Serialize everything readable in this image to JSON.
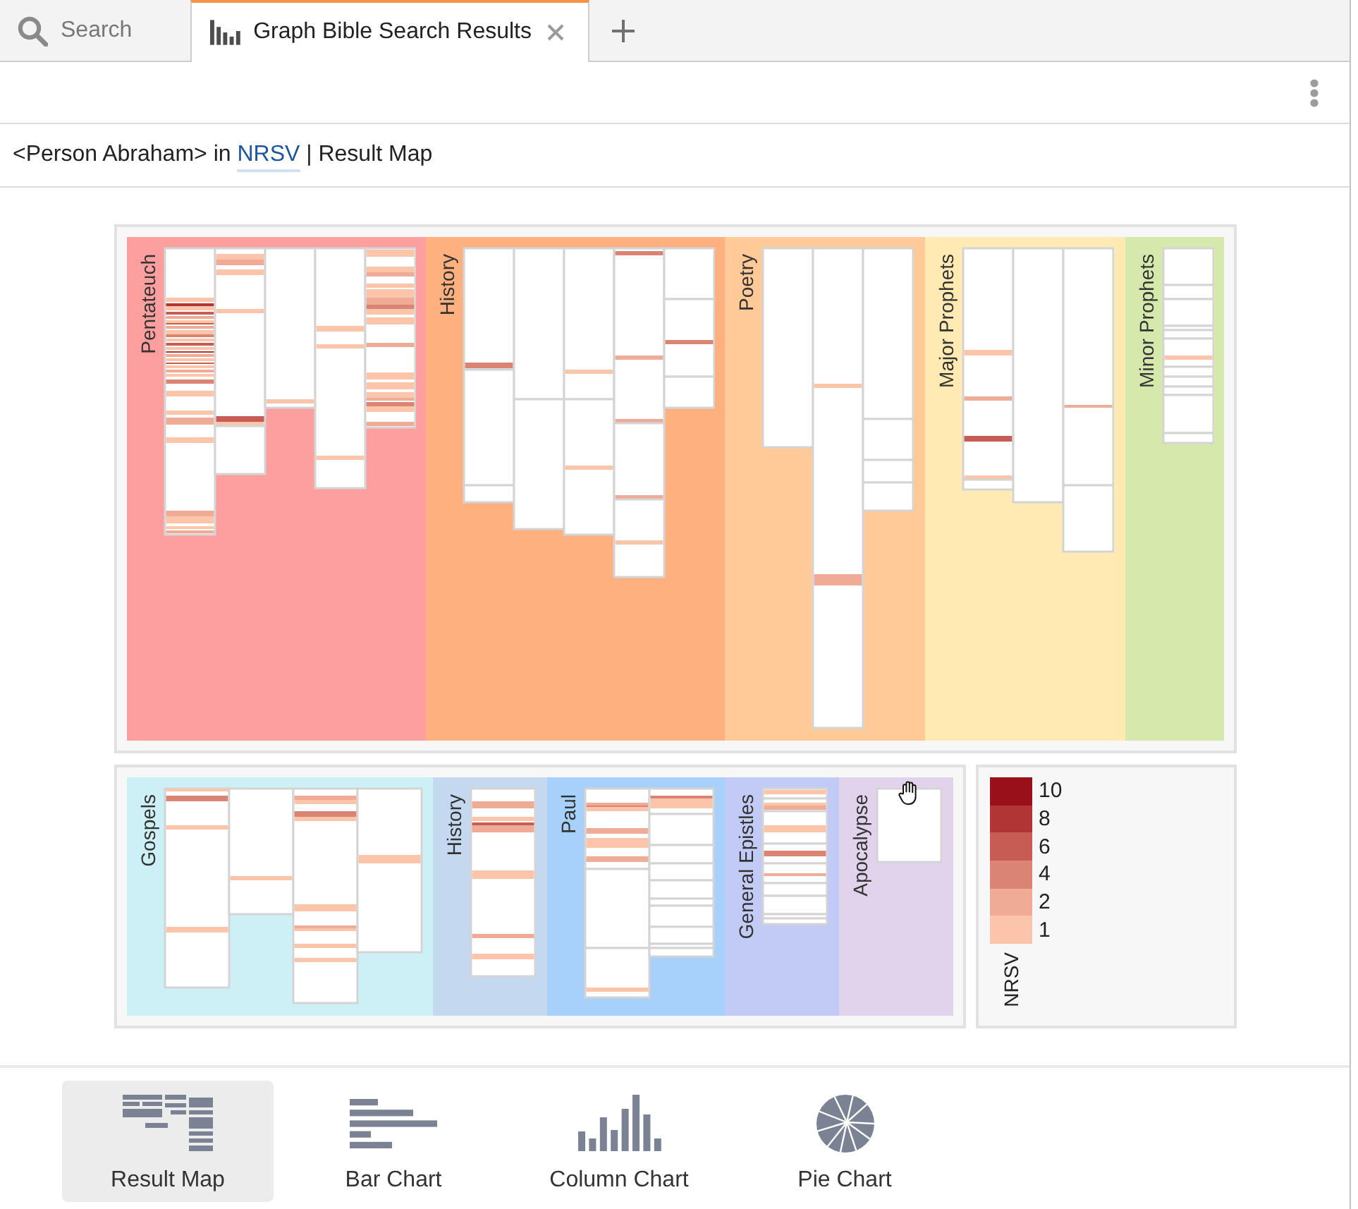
{
  "tabs": [
    {
      "kind": "search",
      "label": "Search",
      "selected": false
    },
    {
      "kind": "graph",
      "label": "Graph Bible Search Results",
      "selected": true
    }
  ],
  "query_line": {
    "before_link": "<Person Abraham> in",
    "link": "NRSV",
    "after_link": "| Result Map"
  },
  "result_map": {
    "groups": [
      {
        "sections": [
          {
            "label": "Pentateuch",
            "color": "#fe9f9f"
          },
          {
            "label": "History",
            "color": "#ffb07f"
          },
          {
            "label": "Poetry",
            "color": "#ffca98"
          },
          {
            "label": "Major Prophets",
            "color": "#ffeab4"
          },
          {
            "label": "Minor Prophets",
            "color": "#d6e9ac"
          }
        ]
      },
      {
        "sections": [
          {
            "label": "Gospels",
            "color": "#ccf0f5"
          },
          {
            "label": "History",
            "color": "#c4d9f0"
          },
          {
            "label": "Paul",
            "color": "#a7d0fb"
          },
          {
            "label": "General Epistles",
            "color": "#c2cbf5"
          },
          {
            "label": "Apocalypse",
            "color": "#e2d3ec"
          }
        ]
      }
    ],
    "legend": {
      "title": "NRSV",
      "items": [
        {
          "label": "10",
          "color": "#990f1a"
        },
        {
          "label": "8",
          "color": "#b13535"
        },
        {
          "label": "6",
          "color": "#c65c54"
        },
        {
          "label": "4",
          "color": "#da8474"
        },
        {
          "label": "2",
          "color": "#efab96"
        },
        {
          "label": "1",
          "color": "#fcc4a9"
        }
      ]
    }
  },
  "view_buttons": [
    {
      "kind": "result-map",
      "label": "Result Map",
      "selected": true
    },
    {
      "kind": "bar",
      "label": "Bar Chart",
      "selected": false
    },
    {
      "kind": "column",
      "label": "Column Chart",
      "selected": false
    },
    {
      "kind": "pie",
      "label": "Pie Chart",
      "selected": false
    }
  ]
}
